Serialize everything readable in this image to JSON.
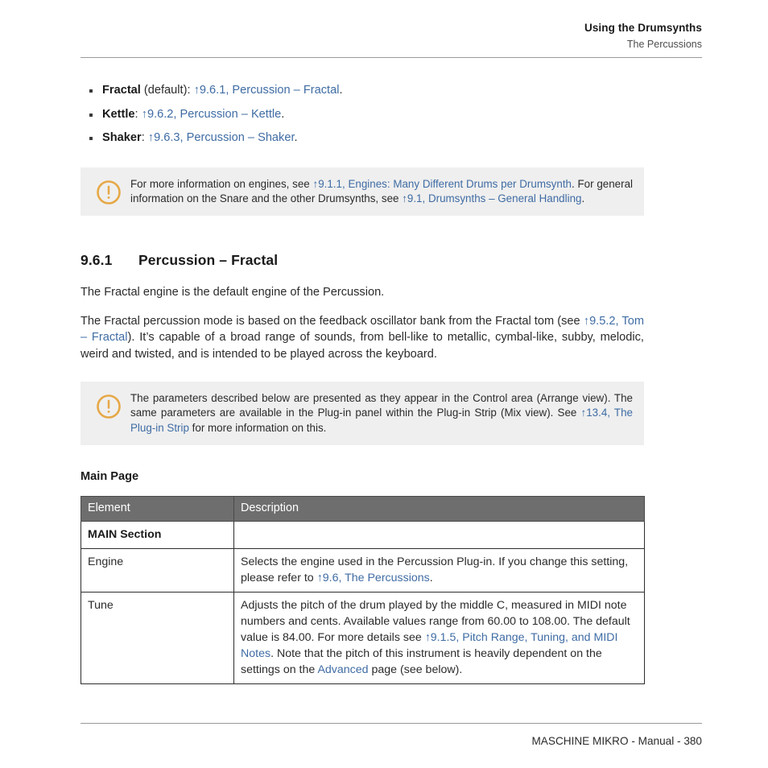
{
  "header": {
    "title": "Using the Drumsynths",
    "subtitle": "The Percussions"
  },
  "bullets": [
    {
      "term": "Fractal",
      "mid": " (default): ",
      "link": "↑9.6.1, Percussion – Fractal",
      "tail": "."
    },
    {
      "term": "Kettle",
      "mid": ": ",
      "link": "↑9.6.2, Percussion – Kettle",
      "tail": "."
    },
    {
      "term": "Shaker",
      "mid": ": ",
      "link": "↑9.6.3, Percussion – Shaker",
      "tail": "."
    }
  ],
  "note1": {
    "icon": "alert-circle-icon",
    "text_a": "For more information on engines, see ",
    "link_a": "↑9.1.1, Engines: Many Different Drums per Drumsynth",
    "text_b": ". For general information on the Snare and the other Drumsynths, see ",
    "link_b": "↑9.1, Drumsynths – General Handling",
    "text_c": "."
  },
  "section": {
    "number": "9.6.1",
    "title": "Percussion – Fractal",
    "intro": "The Fractal engine is the default engine of the Percussion.",
    "para_a": "The Fractal percussion mode is based on the feedback oscillator bank from the Fractal tom (see ",
    "para_link": "↑9.5.2, Tom – Fractal",
    "para_b": "). It’s capable of a broad range of sounds, from bell-like to metallic, cymbal-like, subby, melodic, weird and twisted, and is intended to be played across the keyboard."
  },
  "note2": {
    "icon": "alert-circle-icon",
    "text_a": "The parameters described below are presented as they appear in the Control area (Arrange view). The same parameters are available in the Plug-in panel within the Plug-in Strip (Mix view). See ",
    "link_a": "↑13.4, The Plug-in Strip",
    "text_b": " for more information on this."
  },
  "main_page": {
    "heading": "Main Page",
    "columns": [
      "Element",
      "Description"
    ],
    "rows": [
      {
        "element": "MAIN Section",
        "element_style": "strong",
        "desc_a": "",
        "desc_link": "",
        "desc_b": "",
        "desc_link2": "",
        "desc_c": "",
        "desc_link3": "",
        "desc_d": ""
      },
      {
        "element": "Engine",
        "element_style": "link",
        "desc_a": "Selects the engine used in the Percussion Plug-in. If you change this setting, please refer to ",
        "desc_link": "↑9.6, The Percussions",
        "desc_b": ".",
        "desc_link2": "",
        "desc_c": "",
        "desc_link3": "",
        "desc_d": ""
      },
      {
        "element": "Tune",
        "element_style": "link",
        "desc_a": "Adjusts the pitch of the drum played by the middle C, measured in MIDI note numbers and cents. Available values range from 60.00 to 108.00. The default value is 84.00. For more details see ",
        "desc_link": "↑9.1.5, Pitch Range, Tuning, and MIDI Notes",
        "desc_b": ". Note that the pitch of this instrument is heavily dependent on the settings on the ",
        "desc_link2": "Advanced",
        "desc_c": " page (see below).",
        "desc_link3": "",
        "desc_d": ""
      }
    ]
  },
  "footer": {
    "text": "MASCHINE MIKRO - Manual - 380"
  },
  "colors": {
    "link": "#3f6ca4",
    "table_header_bg": "#6e6e6e",
    "note_bg": "#efefef",
    "note_icon": "#e6a847",
    "rule": "#9a9a9a"
  }
}
